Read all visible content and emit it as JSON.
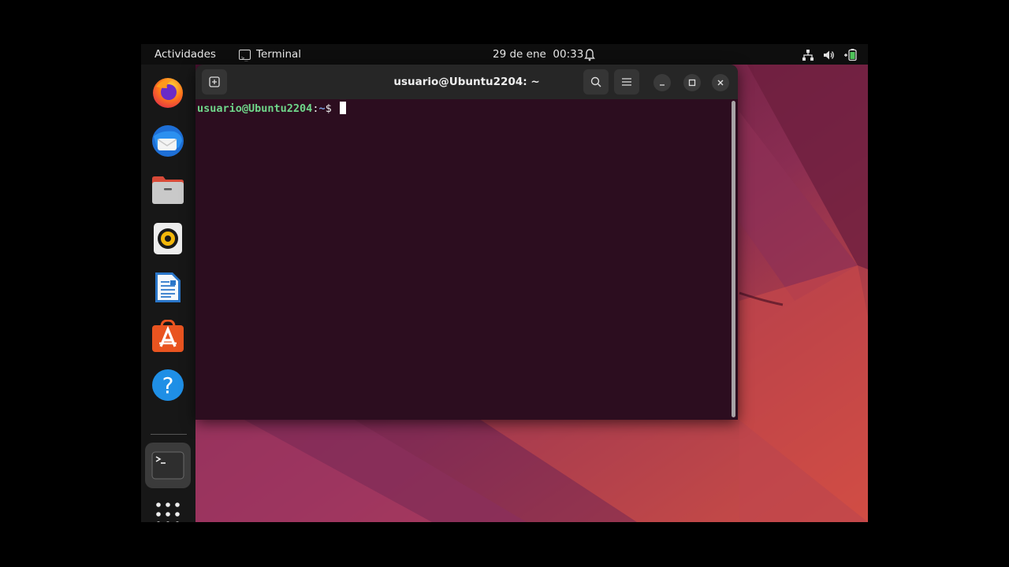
{
  "topbar": {
    "activities_label": "Actividades",
    "app_label": "Terminal",
    "date": "29 de ene",
    "time": "00:33"
  },
  "dock": {
    "items": [
      {
        "name": "firefox-icon"
      },
      {
        "name": "thunderbird-icon"
      },
      {
        "name": "files-icon"
      },
      {
        "name": "rhythmbox-icon"
      },
      {
        "name": "libreoffice-writer-icon"
      },
      {
        "name": "app-center-icon"
      },
      {
        "name": "help-icon"
      },
      {
        "name": "terminal-icon"
      },
      {
        "name": "show-apps-icon"
      }
    ]
  },
  "terminal": {
    "title": "usuario@Ubuntu2204: ~",
    "prompt_user": "usuario@Ubuntu2204",
    "prompt_colon": ":",
    "prompt_path": "~",
    "prompt_symbol": "$ "
  },
  "colors": {
    "terminal_bg": "#2c0d1f",
    "prompt_user": "#6fd68a",
    "prompt_path": "#7aa0e0",
    "accent": "#e95420"
  }
}
